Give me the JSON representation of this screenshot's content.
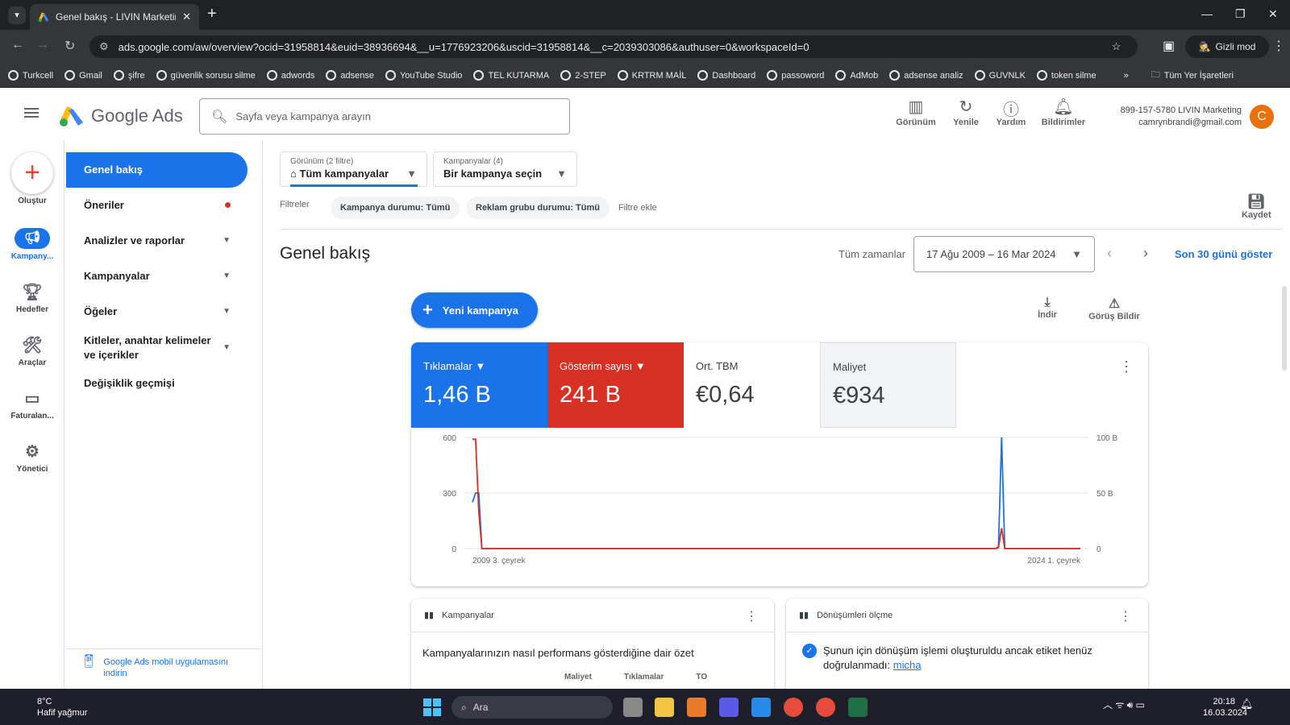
{
  "browser": {
    "tab_title": "Genel bakış - LIVIN Marketing -",
    "url": "ads.google.com/aw/overview?ocid=31958814&euid=38936694&__u=1776923206&uscid=31958814&__c=2039303086&authuser=0&workspaceId=0",
    "incognito_label": "Gizli mod",
    "bookmarks": [
      "Turkcell",
      "Gmail",
      "şifre",
      "güvenlik sorusu silme",
      "adwords",
      "adsense",
      "YouTube Studio",
      "TEL KUTARMA",
      "2-STEP",
      "KRTRM MAİL",
      "Dashboard",
      "passoword",
      "AdMob",
      "adsense analiz",
      "GUVNLK",
      "token silme"
    ],
    "all_bookmarks": "Tüm Yer İşaretleri"
  },
  "header": {
    "product": "Google Ads",
    "search_placeholder": "Sayfa veya kampanya arayın",
    "actions": [
      "Görünüm",
      "Yenile",
      "Yardım",
      "Bildirimler"
    ],
    "account_line1": "899-157-5780 LIVIN Marketing",
    "account_line2": "camrynbrandi@gmail.com",
    "avatar_letter": "C"
  },
  "rail": {
    "create": "Oluştur",
    "items": [
      "Kampany...",
      "Hedefler",
      "Araçlar",
      "Faturalan...",
      "Yönetici"
    ]
  },
  "nav": {
    "active": "Genel bakış",
    "items": [
      "Öneriler",
      "Analizler ve raporlar",
      "Kampanyalar",
      "Öğeler",
      "Kitleler, anahtar kelimeler ve içerikler",
      "Değişiklik geçmişi"
    ],
    "mobile_link": "Google Ads mobil uygulamasını indirin"
  },
  "filters": {
    "view_label": "Görünüm (2 filtre)",
    "view_value": "Tüm kampanyalar",
    "campaigns_label": "Kampanyalar (4)",
    "campaigns_value": "Bir kampanya seçin",
    "filters_label": "Filtreler",
    "chips": [
      "Kampanya durumu: Tümü",
      "Reklam grubu durumu: Tümü"
    ],
    "add_filter": "Filtre ekle",
    "save": "Kaydet"
  },
  "main": {
    "title": "Genel bakış",
    "all_time": "Tüm zamanlar",
    "date_range": "17 Ağu 2009 – 16 Mar 2024",
    "last30": "Son 30 günü göster",
    "new_campaign": "Yeni kampanya",
    "download": "İndir",
    "feedback": "Görüş Bildir"
  },
  "metrics": [
    {
      "label": "Tıklamalar",
      "value": "1,46 B",
      "color": "#1a73e8"
    },
    {
      "label": "Gösterim sayısı",
      "value": "241 B",
      "color": "#d93025"
    },
    {
      "label": "Ort. TBM",
      "value": "€0,64",
      "color": "#ffffff"
    },
    {
      "label": "Maliyet",
      "value": "€934",
      "color": "#f1f3f4"
    }
  ],
  "chart_data": {
    "type": "line",
    "x_labels": [
      "2009 3. çeyrek",
      "2024 1. çeyrek"
    ],
    "left_ticks": [
      "600",
      "300",
      "0"
    ],
    "right_ticks": [
      "100 B",
      "50 B",
      "0"
    ],
    "ylim_left": [
      0,
      600
    ],
    "ylim_right": [
      0,
      100
    ],
    "series": [
      {
        "name": "Tıklamalar",
        "color": "#1a73e8",
        "values": [
          250,
          300,
          300,
          0,
          0,
          0,
          0,
          0,
          0,
          0,
          0,
          0,
          0,
          0,
          0,
          0,
          0,
          0,
          0,
          0,
          0,
          0,
          0,
          0,
          0,
          0,
          0,
          0,
          0,
          0,
          0,
          0,
          0,
          0,
          0,
          0,
          0,
          0,
          0,
          0,
          0,
          0,
          0,
          0,
          0,
          0,
          0,
          0,
          0,
          0,
          0,
          0,
          0,
          0,
          0,
          0,
          0,
          0,
          0,
          0,
          0,
          0,
          0,
          0,
          0,
          0,
          0,
          0,
          0,
          0,
          0,
          0,
          0,
          0,
          0,
          0,
          0,
          0,
          0,
          0,
          0,
          0,
          0,
          0,
          0,
          0,
          0,
          0,
          0,
          0,
          0,
          0,
          0,
          0,
          0,
          0,
          0,
          0,
          0,
          0,
          0,
          0,
          0,
          0,
          0,
          0,
          0,
          0,
          0,
          0,
          0,
          0,
          0,
          0,
          0,
          0,
          0,
          0,
          0,
          0,
          0,
          0,
          0,
          0,
          0,
          0,
          0,
          0,
          0,
          0,
          0,
          0,
          0,
          0,
          0,
          0,
          0,
          0,
          0,
          0,
          0,
          0,
          0,
          0,
          0,
          0,
          0,
          0,
          0,
          0,
          0,
          0,
          0,
          0,
          0,
          0,
          0,
          0,
          0,
          0,
          0,
          0,
          0,
          0,
          0,
          0,
          0,
          10,
          600,
          0,
          0,
          0,
          0,
          0,
          0,
          0,
          0,
          0,
          0,
          0,
          0,
          0,
          0,
          0,
          0,
          0,
          0,
          0,
          0,
          0,
          0,
          0,
          0,
          0
        ]
      },
      {
        "name": "Gösterim sayısı",
        "color": "#d93025",
        "values": [
          590,
          590,
          200,
          0,
          0,
          0,
          0,
          0,
          0,
          0,
          0,
          0,
          0,
          0,
          0,
          0,
          0,
          0,
          0,
          0,
          0,
          0,
          0,
          0,
          0,
          0,
          0,
          0,
          0,
          0,
          0,
          0,
          0,
          0,
          0,
          0,
          0,
          0,
          0,
          0,
          0,
          0,
          0,
          0,
          0,
          0,
          0,
          0,
          0,
          0,
          0,
          0,
          0,
          0,
          0,
          0,
          0,
          0,
          0,
          0,
          0,
          0,
          0,
          0,
          0,
          0,
          0,
          0,
          0,
          0,
          0,
          0,
          0,
          0,
          0,
          0,
          0,
          0,
          0,
          0,
          0,
          0,
          0,
          0,
          0,
          0,
          0,
          0,
          0,
          0,
          0,
          0,
          0,
          0,
          0,
          0,
          0,
          0,
          0,
          0,
          0,
          0,
          0,
          0,
          0,
          0,
          0,
          0,
          0,
          0,
          0,
          0,
          0,
          0,
          0,
          0,
          0,
          0,
          0,
          0,
          0,
          0,
          0,
          0,
          0,
          0,
          0,
          0,
          0,
          0,
          0,
          0,
          0,
          0,
          0,
          0,
          0,
          0,
          0,
          0,
          0,
          0,
          0,
          0,
          0,
          0,
          0,
          0,
          0,
          0,
          0,
          0,
          0,
          0,
          0,
          0,
          0,
          0,
          0,
          0,
          0,
          0,
          0,
          0,
          0,
          0,
          0,
          5,
          110,
          0,
          0,
          0,
          0,
          0,
          0,
          0,
          0,
          0,
          0,
          0,
          0,
          0,
          0,
          0,
          0,
          0,
          0,
          0,
          0,
          0,
          0,
          0,
          0,
          0
        ]
      }
    ]
  },
  "cards": {
    "campaigns_title": "Kampanyalar",
    "campaigns_body": "Kampanyalarınızın nasıl performans gösterdiğine dair özet",
    "campaigns_cols": [
      "Maliyet",
      "Tıklamalar",
      "TO"
    ],
    "conv_title": "Dönüşümleri ölçme",
    "conv_body": "Şunun için dönüşüm işlemi oluşturuldu ancak etiket henüz doğrulanmadı:",
    "conv_link": "micha"
  },
  "taskbar": {
    "weather_temp": "8°C",
    "weather_desc": "Hafif yağmur",
    "search": "Ara",
    "time": "20:18",
    "date": "16.03.2024"
  }
}
